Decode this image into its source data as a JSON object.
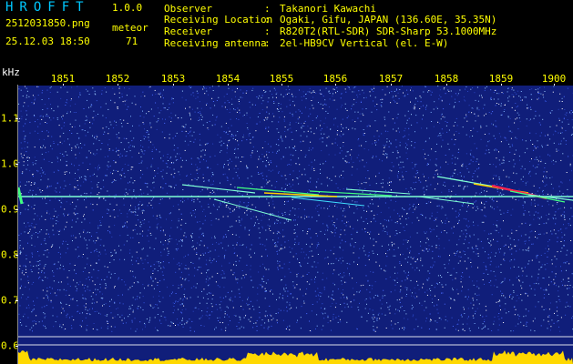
{
  "app": {
    "name": "HROFFT",
    "version": "1.0.0"
  },
  "file": "2512031850.png",
  "datetime": "25.12.03 18:50",
  "meteor": {
    "label": "meteor",
    "count": "71"
  },
  "info": [
    {
      "key": "Observer",
      "value": "Takanori Kawachi"
    },
    {
      "key": "Receiving Location",
      "value": "Ogaki, Gifu, JAPAN (136.60E, 35.35N)"
    },
    {
      "key": "Receiver",
      "value": "R820T2(RTL-SDR) SDR-Sharp 53.1000MHz"
    },
    {
      "key": "Receiving antenna",
      "value": "2el-HB9CV Vertical (el. E-W)"
    }
  ],
  "axes": {
    "y_unit": "kHz",
    "x_ticks": [
      "1851",
      "1852",
      "1853",
      "1854",
      "1855",
      "1856",
      "1857",
      "1858",
      "1859",
      "1900"
    ],
    "y_ticks": [
      "1.1",
      "1.0",
      "0.9",
      "0.8",
      "0.7",
      "0.6"
    ]
  },
  "colors": {
    "background": "#101e7a",
    "text": "#ffff00",
    "carrier": "#7fffd4",
    "echo_strong": "#ff2050",
    "level_bar": "#ffd800"
  }
}
